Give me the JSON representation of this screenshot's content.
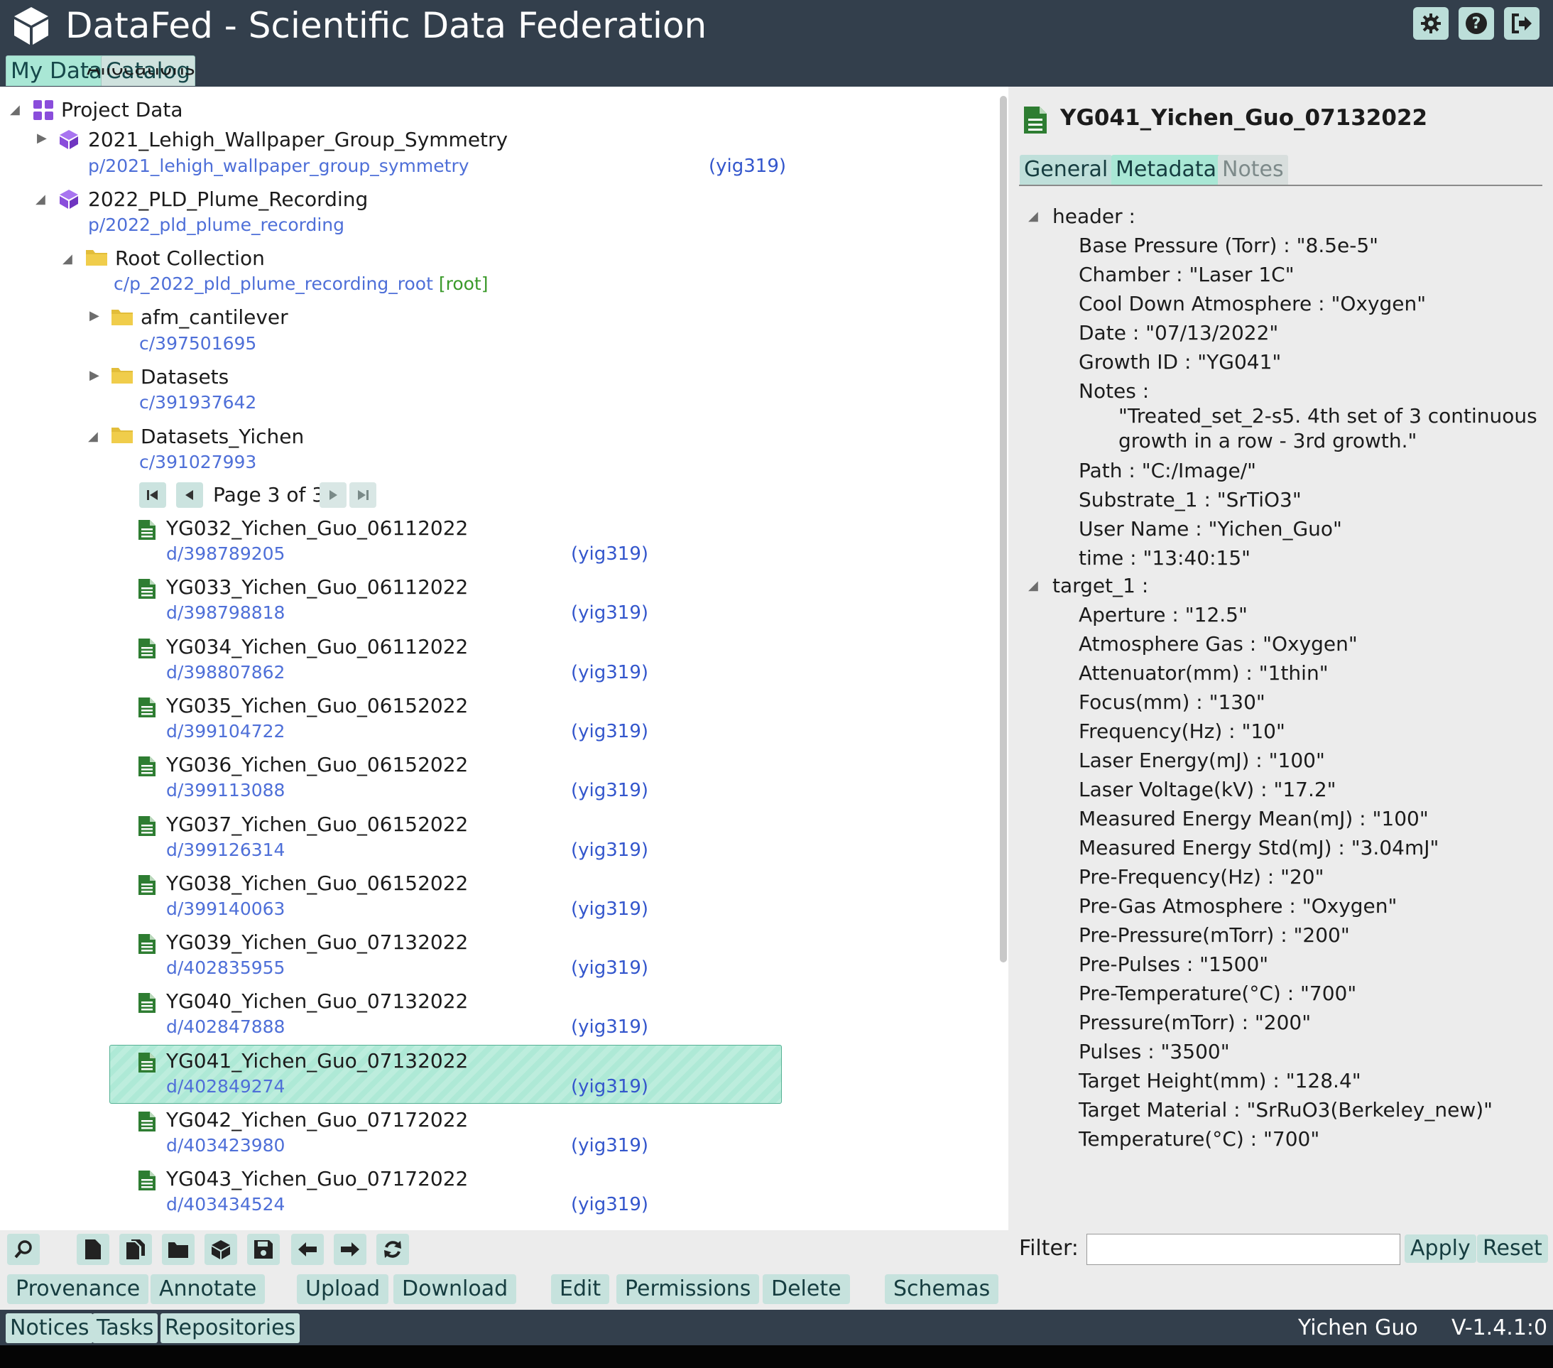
{
  "header": {
    "title": "DataFed - Scientific Data Federation",
    "icons": [
      "settings-icon",
      "help-icon",
      "logout-icon"
    ]
  },
  "top_tabs": [
    "My Data",
    "Catalog"
  ],
  "tree": {
    "partial_label": "Allocations",
    "project_data_label": "Project Data",
    "projects": [
      {
        "title": "2021_Lehigh_Wallpaper_Group_Symmetry",
        "path": "p/2021_lehigh_wallpaper_group_symmetry",
        "owner": "(yig319)"
      },
      {
        "title": "2022_PLD_Plume_Recording",
        "path": "p/2022_pld_plume_recording"
      }
    ],
    "root_collection": {
      "title": "Root Collection",
      "path": "c/p_2022_pld_plume_recording_root",
      "tag": "[root]"
    },
    "collections": [
      {
        "title": "afm_cantilever",
        "path": "c/397501695"
      },
      {
        "title": "Datasets",
        "path": "c/391937642"
      },
      {
        "title": "Datasets_Yichen",
        "path": "c/391027993"
      }
    ],
    "pager_label": "Page 3 of 3",
    "records": [
      {
        "title": "YG032_Yichen_Guo_06112022",
        "id": "d/398789205",
        "owner": "(yig319)"
      },
      {
        "title": "YG033_Yichen_Guo_06112022",
        "id": "d/398798818",
        "owner": "(yig319)"
      },
      {
        "title": "YG034_Yichen_Guo_06112022",
        "id": "d/398807862",
        "owner": "(yig319)"
      },
      {
        "title": "YG035_Yichen_Guo_06152022",
        "id": "d/399104722",
        "owner": "(yig319)"
      },
      {
        "title": "YG036_Yichen_Guo_06152022",
        "id": "d/399113088",
        "owner": "(yig319)"
      },
      {
        "title": "YG037_Yichen_Guo_06152022",
        "id": "d/399126314",
        "owner": "(yig319)"
      },
      {
        "title": "YG038_Yichen_Guo_06152022",
        "id": "d/399140063",
        "owner": "(yig319)"
      },
      {
        "title": "YG039_Yichen_Guo_07132022",
        "id": "d/402835955",
        "owner": "(yig319)"
      },
      {
        "title": "YG040_Yichen_Guo_07132022",
        "id": "d/402847888",
        "owner": "(yig319)"
      },
      {
        "title": "YG041_Yichen_Guo_07132022",
        "id": "d/402849274",
        "owner": "(yig319)",
        "selected": true
      },
      {
        "title": "YG042_Yichen_Guo_07172022",
        "id": "d/403423980",
        "owner": "(yig319)"
      },
      {
        "title": "YG043_Yichen_Guo_07172022",
        "id": "d/403434524",
        "owner": "(yig319)"
      }
    ]
  },
  "detail": {
    "title": "YG041_Yichen_Guo_07132022",
    "tabs": [
      "General",
      "Metadata",
      "Notes"
    ],
    "header_group": "header :",
    "header_lines": [
      "Base Pressure (Torr) : \"8.5e-5\"",
      "Chamber : \"Laser 1C\"",
      "Cool Down Atmosphere : \"Oxygen\"",
      "Date : \"07/13/2022\"",
      "Growth ID : \"YG041\"",
      "Notes :",
      "\"Treated_set_2-s5. 4th set of 3 continuous",
      "growth in a row - 3rd growth.\"",
      "Path : \"C:/Image/\"",
      "Substrate_1 : \"SrTiO3\"",
      "User Name : \"Yichen_Guo\"",
      "time : \"13:40:15\""
    ],
    "target_group": "target_1 :",
    "target_lines": [
      "Aperture : \"12.5\"",
      "Atmosphere Gas : \"Oxygen\"",
      "Attenuator(mm) : \"1thin\"",
      "Focus(mm) : \"130\"",
      "Frequency(Hz) : \"10\"",
      "Laser Energy(mJ) : \"100\"",
      "Laser Voltage(kV) : \"17.2\"",
      "Measured Energy Mean(mJ) : \"100\"",
      "Measured Energy Std(mJ) : \"3.04mJ\"",
      "Pre-Frequency(Hz) : \"20\"",
      "Pre-Gas Atmosphere : \"Oxygen\"",
      "Pre-Pressure(mTorr) : \"200\"",
      "Pre-Pulses : \"1500\"",
      "Pre-Temperature(°C) : \"700\"",
      "Pressure(mTorr) : \"200\"",
      "Pulses : \"3500\"",
      "Target Height(mm) : \"128.4\"",
      "Target Material : \"SrRuO3(Berkeley_new)\"",
      "Temperature(°C) : \"700\""
    ]
  },
  "toolbar": {
    "icons": [
      "search-icon",
      "new-record-icon",
      "copy-record-icon",
      "new-collection-icon",
      "new-project-icon",
      "save-icon",
      "move-left-icon",
      "move-right-icon",
      "refresh-icon"
    ],
    "actions": [
      "Provenance",
      "Annotate",
      "Upload",
      "Download",
      "Edit",
      "Permissions",
      "Delete",
      "Schemas"
    ],
    "filter_label": "Filter:",
    "filter_value": "",
    "apply_label": "Apply",
    "reset_label": "Reset"
  },
  "footer": {
    "tabs": [
      "Notices",
      "Tasks",
      "Repositories"
    ],
    "user": "Yichen Guo",
    "version": "V-1.4.1:0"
  },
  "colors": {
    "header_bg": "#333f4c",
    "accent": "#a9e7d5",
    "button": "#c6e2dd",
    "link": "#4e6fd8",
    "record_icon": "#2e7d32",
    "folder_icon": "#e2bd3a",
    "project_icon": "#8a4ddb"
  }
}
